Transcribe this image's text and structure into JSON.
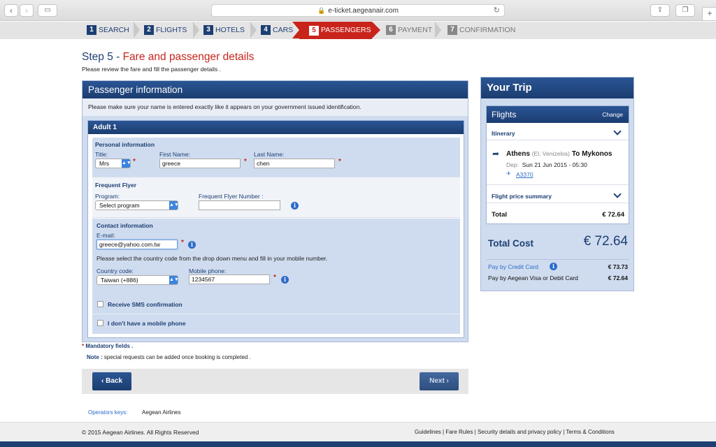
{
  "browser": {
    "url": "e-ticket.aegeanair.com"
  },
  "steps": [
    {
      "num": "1",
      "label": "SEARCH"
    },
    {
      "num": "2",
      "label": "FLIGHTS"
    },
    {
      "num": "3",
      "label": "HOTELS"
    },
    {
      "num": "4",
      "label": "CARS"
    },
    {
      "num": "5",
      "label": "PASSENGERS"
    },
    {
      "num": "6",
      "label": "PAYMENT"
    },
    {
      "num": "7",
      "label": "CONFIRMATION"
    }
  ],
  "heading": {
    "step": "Step 5 - ",
    "title": "Fare and passenger details",
    "subtitle": "Please review the fare and fill the passenger details ."
  },
  "passenger_panel": {
    "title": "Passenger information",
    "note": "Please make sure your name is entered exactly like it appears on your government issued identification.",
    "adult_title": "Adult 1",
    "personal": {
      "title": "Personal information",
      "title_label": "Title:",
      "title_value": "Mrs",
      "first_name_label": "First Name:",
      "first_name_value": "greece",
      "last_name_label": "Last Name:",
      "last_name_value": "chen"
    },
    "frequent_flyer": {
      "title": "Frequent Flyer",
      "program_label": "Program:",
      "program_value": "Select program",
      "number_label": "Frequent Flyer Number :",
      "number_value": ""
    },
    "contact": {
      "title": "Contact information",
      "email_label": "E-mail:",
      "email_value": "greece@yahoo.com.tw",
      "instruction": "Please select the country code from the drop down menu and fill in your mobile number.",
      "country_label": "Country code:",
      "country_value": "Taiwan (+886)",
      "mobile_label": "Mobile phone:",
      "mobile_value": "1234567",
      "sms_label": "Receive SMS confirmation",
      "no_mobile_label": "I don't have a mobile phone"
    },
    "req_mark": "*"
  },
  "mandatory": {
    "star": "*",
    "text": " Mandatory fields ."
  },
  "note": {
    "label": "Note :",
    "text": " special requests can be added once booking is completed ."
  },
  "nav": {
    "back": "Back",
    "next": "Next"
  },
  "operators": {
    "label": "Operators keys:",
    "value": "Aegean Airlines"
  },
  "footer": {
    "copyright": "© 2015 Aegean Airlines. All Rights Reserved",
    "links": "Guidelines | Fare Rules | Security details and privacy policy | Terms & Conditions"
  },
  "trip": {
    "title": "Your Trip",
    "flights_title": "Flights",
    "change": "Change",
    "itinerary": "Itinerary",
    "from": "Athens",
    "from_airport": "(El. Venizelos)",
    "to_word": "To",
    "to": "Mykonos",
    "dep_label": "Dep:",
    "dep_value": "Sun 21 Jun 2015 - 05:30",
    "flight_number": "A3370",
    "price_summary": "Flight price summary",
    "total_label": "Total",
    "total_value": "€ 72.64",
    "total_cost_label": "Total Cost",
    "total_cost_value": "€ 72.64",
    "pay_credit_label": "Pay by Credit Card",
    "pay_credit_value": "€ 73.73",
    "pay_visa_label": "Pay by Aegean Visa or Debit Card",
    "pay_visa_value": "€ 72.64"
  },
  "colors": {
    "brand": "#1d3f73",
    "active_step": "#c8241c",
    "link": "#2d6cc9"
  }
}
